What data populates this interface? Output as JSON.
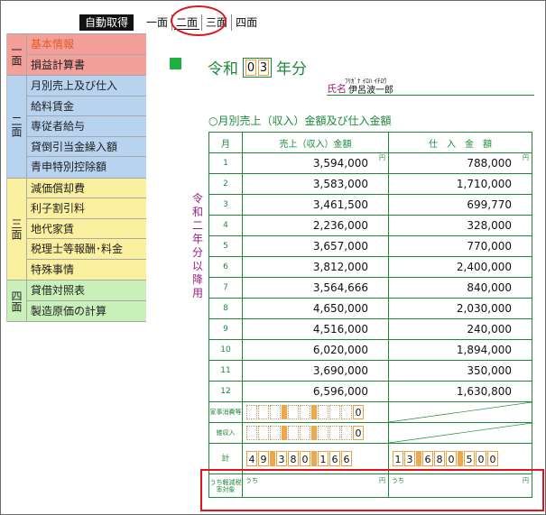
{
  "toolbar": {
    "auto_fetch_label": "自動取得",
    "tabs": [
      {
        "label": "一面"
      },
      {
        "label": "二面"
      },
      {
        "label": "三面"
      },
      {
        "label": "四面"
      }
    ]
  },
  "sidebar": {
    "groups": [
      {
        "label": "一面",
        "items": [
          {
            "label": "基本情報"
          },
          {
            "label": "損益計算書"
          }
        ]
      },
      {
        "label": "二面",
        "items": [
          {
            "label": "月別売上及び仕入"
          },
          {
            "label": "給料賃金"
          },
          {
            "label": "専従者給与"
          },
          {
            "label": "貸倒引当金繰入額"
          },
          {
            "label": "青申特別控除額"
          }
        ]
      },
      {
        "label": "三面",
        "items": [
          {
            "label": "減価償却費"
          },
          {
            "label": "利子割引料"
          },
          {
            "label": "地代家賃"
          },
          {
            "label": "税理士等報酬･料金"
          },
          {
            "label": "特殊事情"
          }
        ]
      },
      {
        "label": "四面",
        "items": [
          {
            "label": "貸借対照表"
          },
          {
            "label": "製造原価の計算"
          }
        ]
      }
    ]
  },
  "form": {
    "era": "令和",
    "year_digits": [
      "0",
      "3"
    ],
    "year_suffix": "年分",
    "name_label": "氏名",
    "name_furigana": "ﾌﾘｶﾞﾅ ｲﾛﾊ ｲﾁﾛｳ",
    "name_value": "伊呂波一郎",
    "section_title": "○月別売上（収入）金額及び仕入金額",
    "side_note": "令和二年分以降用",
    "table": {
      "headers": [
        "月",
        "売上（収入）金額",
        "仕　入　金　額"
      ],
      "yen_mark": "円",
      "rows": [
        {
          "month": "1",
          "sales": "3,594,000",
          "purchases": "788,000"
        },
        {
          "month": "2",
          "sales": "3,583,000",
          "purchases": "1,710,000"
        },
        {
          "month": "3",
          "sales": "3,461,500",
          "purchases": "699,770"
        },
        {
          "month": "4",
          "sales": "2,236,000",
          "purchases": "328,000"
        },
        {
          "month": "5",
          "sales": "3,657,000",
          "purchases": "770,000"
        },
        {
          "month": "6",
          "sales": "3,812,000",
          "purchases": "2,400,000"
        },
        {
          "month": "7",
          "sales": "3,564,666",
          "purchases": "840,000"
        },
        {
          "month": "8",
          "sales": "4,650,000",
          "purchases": "2,030,000"
        },
        {
          "month": "9",
          "sales": "4,516,000",
          "purchases": "240,000"
        },
        {
          "month": "10",
          "sales": "6,020,000",
          "purchases": "1,894,000"
        },
        {
          "month": "11",
          "sales": "3,690,000",
          "purchases": "350,000"
        },
        {
          "month": "12",
          "sales": "6,596,000",
          "purchases": "1,630,800"
        }
      ],
      "household_label": "家事消費等",
      "household_value": "0",
      "misc_label": "雑収入",
      "misc_value": "0",
      "total_label": "計",
      "total_sales_digits": [
        "4",
        "9",
        "3",
        "8",
        "0",
        "1",
        "6",
        "6"
      ],
      "total_purchases_digits": [
        "1",
        "3",
        "6",
        "8",
        "0",
        "5",
        "0",
        "0"
      ],
      "reduced_label": "うち軽減税率対象",
      "uchi": "うち"
    }
  }
}
